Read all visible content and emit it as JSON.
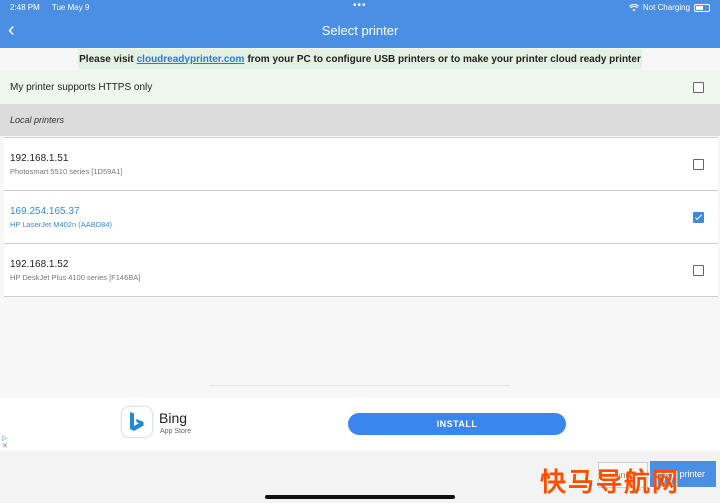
{
  "status_bar": {
    "time": "2:48 PM",
    "date": "Tue May 9",
    "dots": "•••",
    "charging": "Not Charging"
  },
  "header": {
    "back_icon": "chevron-left-icon",
    "back_glyph": "‹",
    "title": "Select printer"
  },
  "banner": {
    "prefix": "Please visit",
    "link": "cloudreadyprinter.com",
    "suffix": "from your PC to configure USB printers or to make your printer cloud ready printer"
  },
  "https_option": {
    "label": "My printer supports HTTPS only",
    "checked": false
  },
  "section": {
    "label": "Local printers"
  },
  "printers": [
    {
      "ip": "192.168.1.51",
      "model": "Photosmart 5510 series [1D59A1]",
      "selected": false
    },
    {
      "ip": "169.254.165.37",
      "model": "HP LaserJet M402n (AABD84)",
      "selected": true
    },
    {
      "ip": "192.168.1.52",
      "model": "HP DeskJet Plus 4100 series [F146BA]",
      "selected": false
    }
  ],
  "ad": {
    "app_name": "Bing",
    "store": "App Store",
    "install_label": "INSTALL",
    "adchoices_glyph": "▷",
    "close_glyph": "✕"
  },
  "bottom": {
    "cancel_label": "Cancel",
    "add_label": "Add printer",
    "watermark": "快马导航网"
  },
  "colors": {
    "accent": "#4a8fe3",
    "selected_text": "#3c8ad8",
    "banner_bg": "#e3f1e2",
    "install_bg": "#3a86ef"
  }
}
